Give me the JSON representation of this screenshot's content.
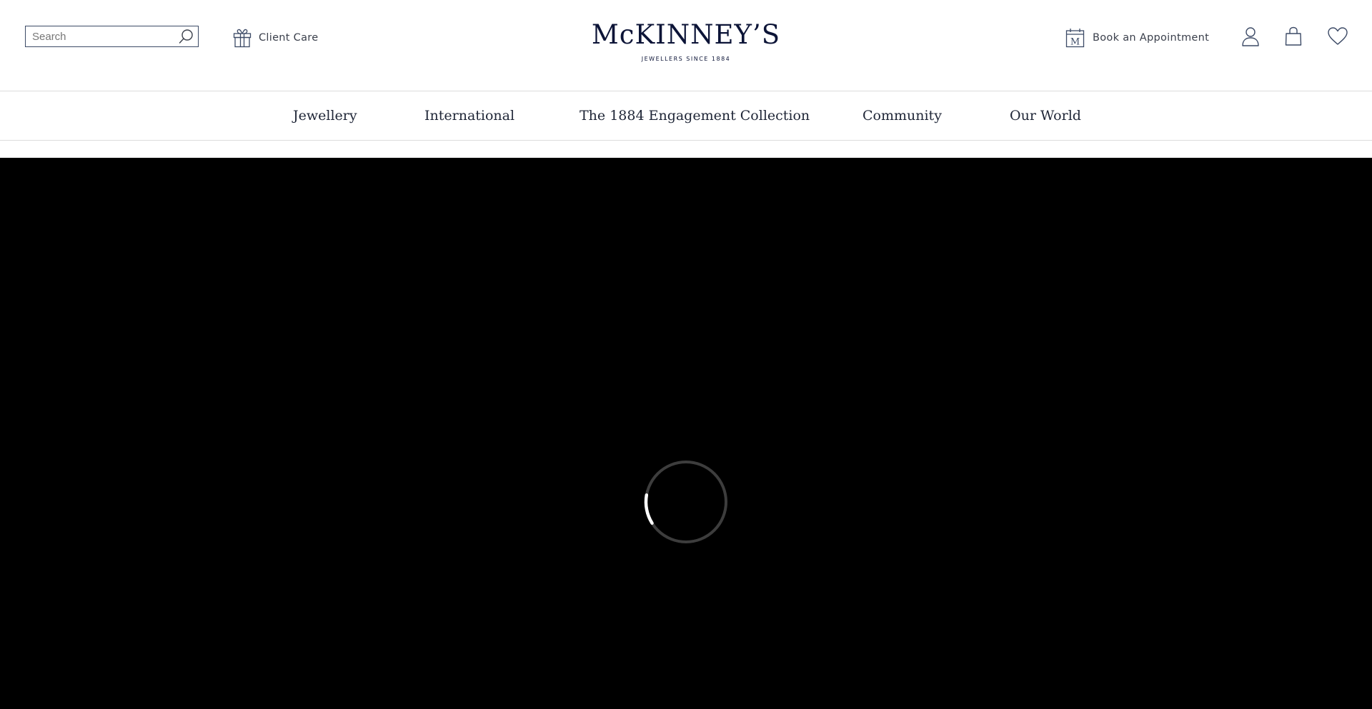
{
  "header": {
    "search": {
      "placeholder": "Search",
      "value": ""
    },
    "client_care_label": "Client Care",
    "logo": {
      "name": "McKINNEY’S",
      "tagline": "JEWELLERS SINCE 1884"
    },
    "book_appointment_label": "Book an Appointment",
    "calendar_letter": "M",
    "icons": [
      "search-icon",
      "gift-icon",
      "calendar-icon",
      "account-icon",
      "bag-icon",
      "heart-icon"
    ]
  },
  "main_nav": {
    "items": [
      {
        "label": "Jewellery"
      },
      {
        "label": "International"
      },
      {
        "label": "The 1884 Engagement Collection"
      },
      {
        "label": "Community"
      },
      {
        "label": "Our World"
      }
    ]
  },
  "hero": {
    "state": "loading",
    "background": "#000000"
  },
  "colors": {
    "brand": "#0c1437",
    "text": "#3a3f4b",
    "border": "#dcdcdc"
  }
}
